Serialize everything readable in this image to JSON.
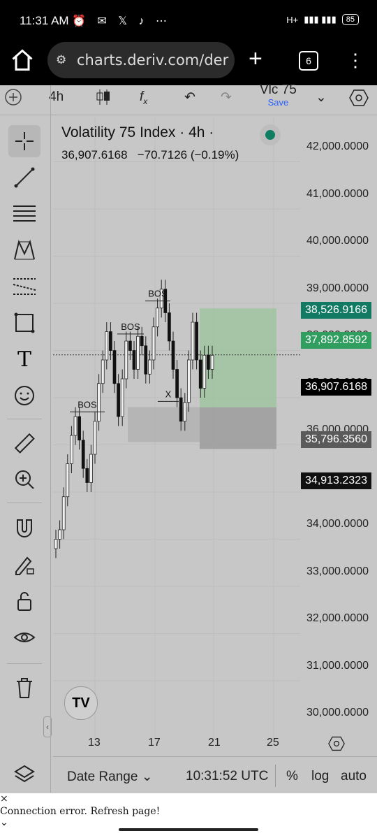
{
  "status": {
    "time": "11:31 AM",
    "network": "H+",
    "battery": "85"
  },
  "browser": {
    "url": "charts.deriv.com/der",
    "tab_count": "6"
  },
  "toolbar": {
    "interval": "4h",
    "symbol_short": "Vlc 75",
    "save_label": "Save"
  },
  "legend": {
    "title": "Volatility 75 Index · 4h ·",
    "price": "36,907.6168",
    "change": "−70.7126 (−0.19%)"
  },
  "price_axis": [
    "42,000.0000",
    "41,000.0000",
    "40,000.0000",
    "39,000.0000",
    "38,000.0000",
    "37,000.0000",
    "36,000.0000",
    "35,000.0000",
    "34,000.0000",
    "33,000.0000",
    "32,000.0000",
    "31,000.0000",
    "30,000.0000"
  ],
  "price_tags": {
    "target": "38,526.9166",
    "entry": "37,892.8592",
    "current": "36,907.6168",
    "stop": "35,796.3560",
    "low": "34,913.2323"
  },
  "colors": {
    "tag_target": "#127a63",
    "tag_entry": "#2f9e5f",
    "tag_current": "#000000",
    "tag_stop": "#5a5a5a",
    "tag_low": "#111111"
  },
  "time_axis": [
    "13",
    "17",
    "21",
    "25"
  ],
  "annotations": {
    "bos1": "BOS",
    "bos2": "BOS",
    "bos3": "BOS",
    "x": "X"
  },
  "bottom": {
    "date_range": "Date Range",
    "clock": "10:31:52 UTC",
    "pct": "%",
    "log": "log",
    "auto": "auto"
  },
  "error": {
    "close": "×",
    "message": "Connection error. Refresh page!",
    "chevron": "⌄"
  },
  "icons": [
    "home-icon",
    "tuner-icon",
    "plus-icon",
    "tabs-icon",
    "kebab-icon",
    "crosshair-icon",
    "trendline-icon",
    "fib-icon",
    "pattern-icon",
    "prediction-icon",
    "shape-icon",
    "text-icon",
    "emoji-icon",
    "ruler-icon",
    "zoom-icon",
    "magnet-icon",
    "pencil-lock-icon",
    "lock-icon",
    "eye-icon",
    "trash-icon",
    "layers-icon",
    "settings-icon"
  ]
}
